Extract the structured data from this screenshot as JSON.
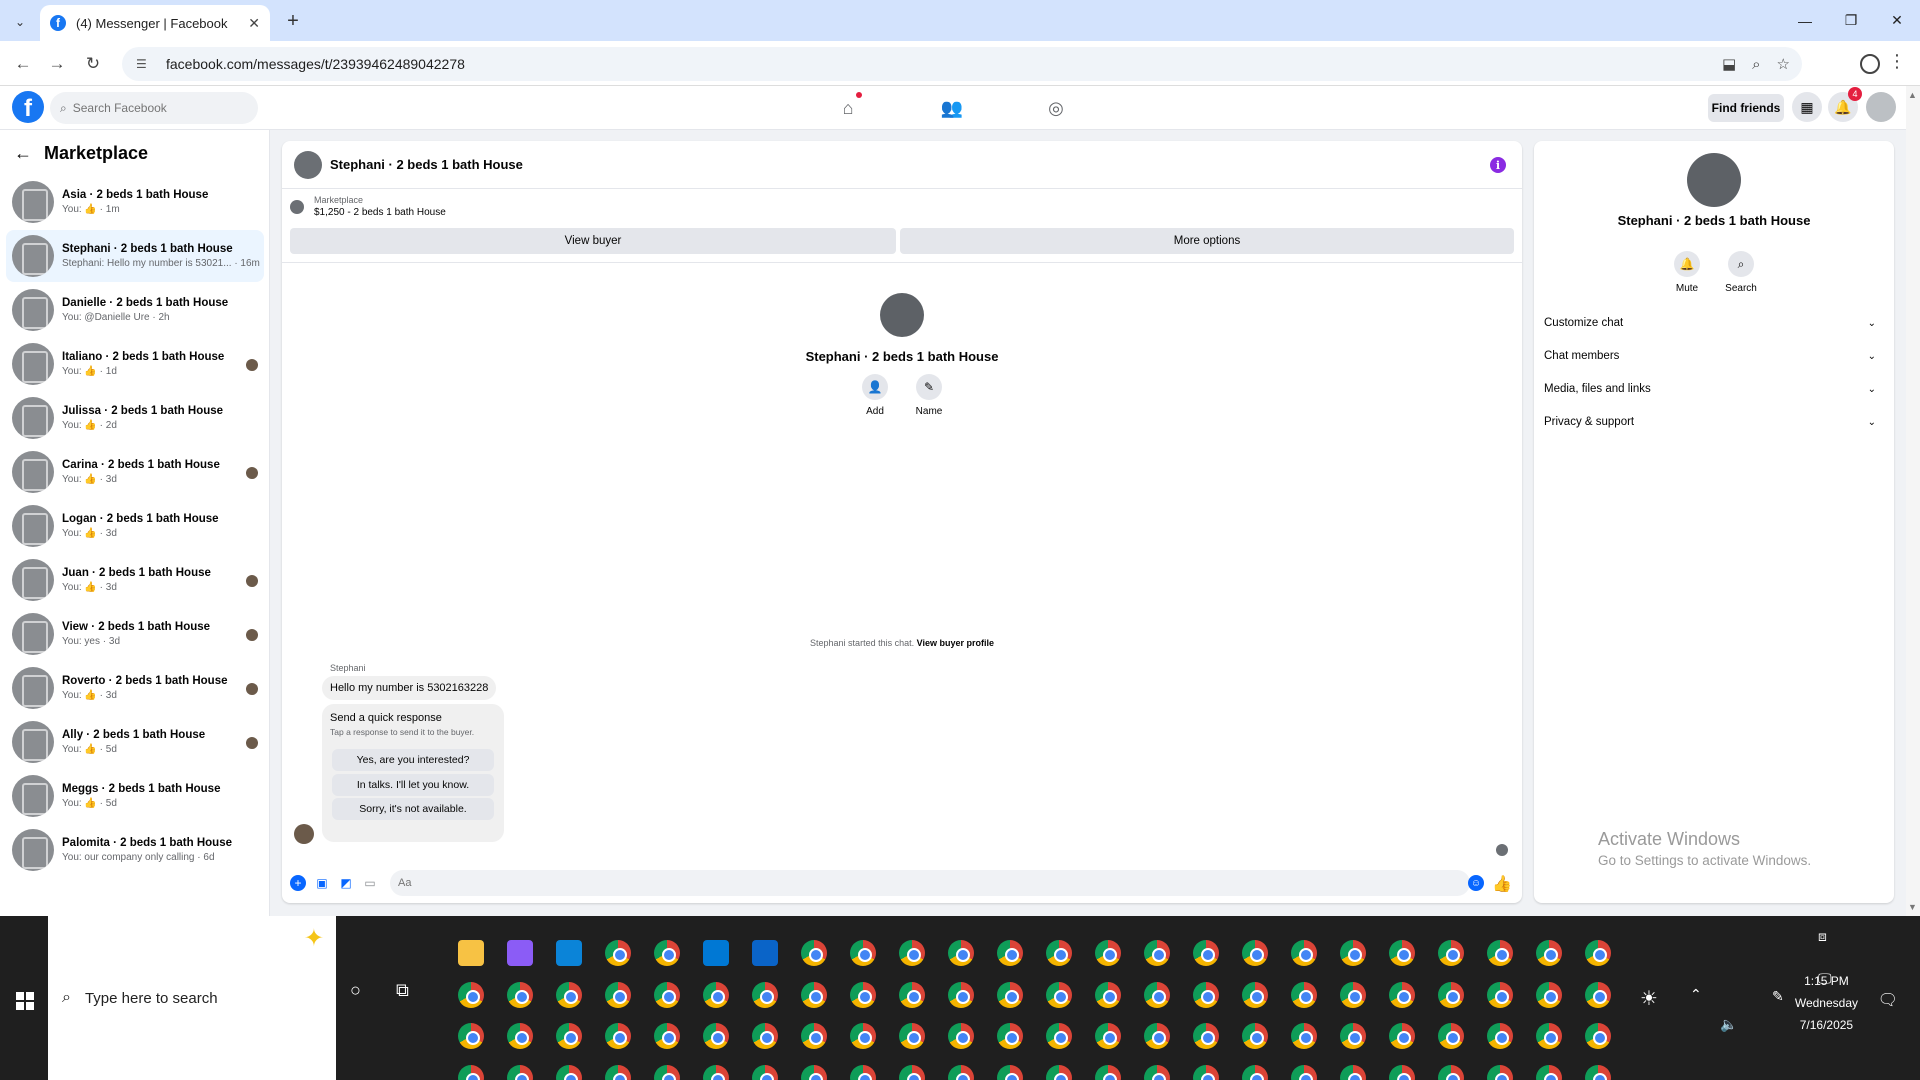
{
  "browser": {
    "tab_title": "(4) Messenger | Facebook",
    "url": "facebook.com/messages/t/23939462489042278",
    "close_tab_glyph": "✕",
    "new_tab_glyph": "+",
    "window": {
      "minimize": "—",
      "restore": "❐",
      "close": "✕"
    }
  },
  "fb_header": {
    "search_placeholder": "Search Facebook",
    "find_friends": "Find friends",
    "notification_count": "4"
  },
  "sidebar": {
    "title": "Marketplace",
    "conversations": [
      {
        "name": "Asia · 2 beds 1 bath House",
        "preview": "You: 👍 · 1m",
        "active": false
      },
      {
        "name": "Stephani · 2 beds 1 bath House",
        "preview": "Stephani: Hello my number is 53021... · 16m",
        "active": true
      },
      {
        "name": "Danielle · 2 beds 1 bath House",
        "preview": "You: @Danielle Ure · 2h",
        "active": false
      },
      {
        "name": "Italiano · 2 beds 1 bath House",
        "preview": "You: 👍 · 1d",
        "active": false
      },
      {
        "name": "Julissa · 2 beds 1 bath House",
        "preview": "You: 👍 · 2d",
        "active": false
      },
      {
        "name": "Carina · 2 beds 1 bath House",
        "preview": "You: 👍 · 3d",
        "active": false
      },
      {
        "name": "Logan · 2 beds 1 bath House",
        "preview": "You: 👍 · 3d",
        "active": false
      },
      {
        "name": "Juan · 2 beds 1 bath House",
        "preview": "You: 👍 · 3d",
        "active": false
      },
      {
        "name": "View · 2 beds 1 bath House",
        "preview": "You: yes · 3d",
        "active": false
      },
      {
        "name": "Roverto · 2 beds 1 bath House",
        "preview": "You: 👍 · 3d",
        "active": false
      },
      {
        "name": "Ally · 2 beds 1 bath House",
        "preview": "You: 👍 · 5d",
        "active": false
      },
      {
        "name": "Meggs · 2 beds 1 bath House",
        "preview": "You: 👍 · 5d",
        "active": false
      },
      {
        "name": "Palomita · 2 beds 1 bath House",
        "preview": "You: our company only calling · 6d",
        "active": false
      }
    ]
  },
  "chat": {
    "title": "Stephani · 2 beds 1 bath House",
    "listing_source": "Marketplace",
    "listing_detail": "$1,250 - 2 beds 1 bath House",
    "view_buyer": "View buyer",
    "more_options": "More options",
    "profile_name": "Stephani · 2 beds 1 bath House",
    "add_label": "Add",
    "name_label": "Name",
    "started_text": "Stephani started this chat.",
    "view_buyer_profile": "View buyer profile",
    "sender": "Stephani",
    "message": "Hello my number is 5302163228",
    "quick_title": "Send a quick response",
    "quick_subtitle": "Tap a response to send it to the buyer.",
    "quick_responses": [
      "Yes, are you interested?",
      "In talks. I'll let you know.",
      "Sorry, it's not available."
    ],
    "composer_placeholder": "Aa"
  },
  "right_panel": {
    "name": "Stephani · 2 beds 1 bath House",
    "mute": "Mute",
    "search": "Search",
    "sections": [
      "Customize chat",
      "Chat members",
      "Media, files and links",
      "Privacy & support"
    ],
    "activate_title": "Activate Windows",
    "activate_sub": "Go to Settings to activate Windows."
  },
  "taskbar": {
    "search_placeholder": "Type here to search",
    "time": "1:15 PM",
    "day": "Wednesday",
    "date": "7/16/2025"
  },
  "colors": {
    "facebook_blue": "#1877f2",
    "messenger_blue": "#0866ff",
    "active_row": "#ebf5ff",
    "taskbar": "#1f1f1f"
  }
}
